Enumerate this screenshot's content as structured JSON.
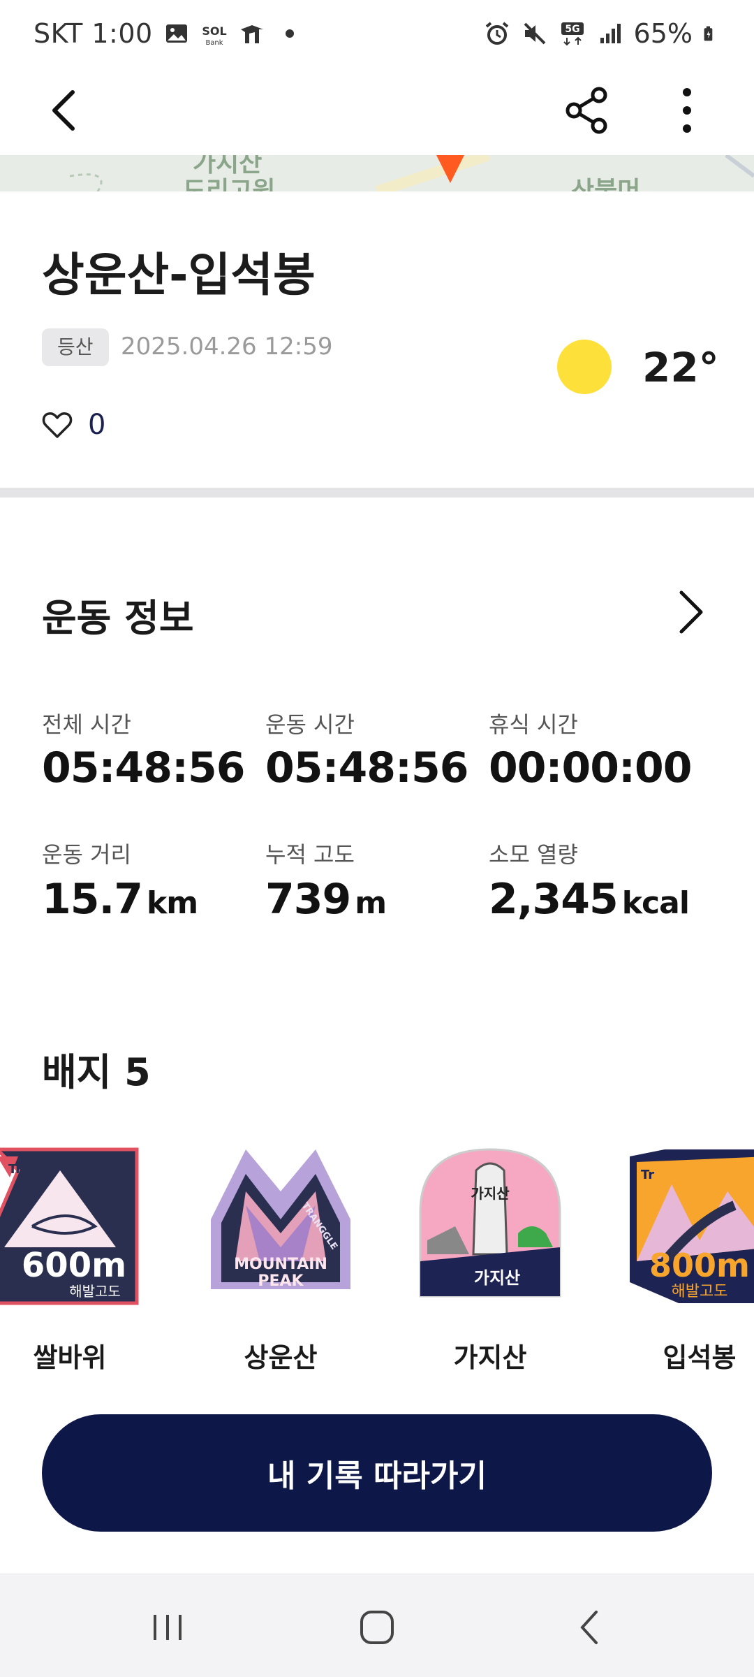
{
  "status_bar": {
    "carrier_time": "SKT 1:00",
    "battery": "65%",
    "notification_icons": [
      "gallery-icon",
      "shinhan-sol-bank-icon",
      "trangle-app-icon",
      "dot-icon"
    ],
    "system_icons": [
      "alarm-icon",
      "mute-icon",
      "5g-icon",
      "signal-icon",
      "battery-icon"
    ],
    "sol_bank_text": "Bank"
  },
  "app_bar": {
    "back_icon": "back-arrow-icon",
    "share_icon": "share-icon",
    "more_icon": "more-vertical-icon"
  },
  "map": {
    "labels": [
      "가지산",
      "도리고원",
      "산불머"
    ]
  },
  "record": {
    "title": "상운산-입석봉",
    "category": "등산",
    "datetime": "2025.04.26 12:59",
    "temperature": "22°",
    "weather_icon": "sun-icon",
    "likes": "0"
  },
  "exercise": {
    "section_title": "운동 정보",
    "stats": [
      {
        "label": "전체 시간",
        "value": "05:48:56",
        "unit": ""
      },
      {
        "label": "운동 시간",
        "value": "05:48:56",
        "unit": ""
      },
      {
        "label": "휴식 시간",
        "value": "00:00:00",
        "unit": ""
      },
      {
        "label": "운동 거리",
        "value": "15.7",
        "unit": "km"
      },
      {
        "label": "누적 고도",
        "value": "739",
        "unit": "m"
      },
      {
        "label": "소모 열량",
        "value": "2,345",
        "unit": "kcal"
      }
    ]
  },
  "badges": {
    "title": "배지 5",
    "items": [
      {
        "name": "쌀바위",
        "art_text": "600m",
        "art_sub": "해발고도",
        "brand": "Tr"
      },
      {
        "name": "상운산",
        "art_text": "MOUNTAIN",
        "art_sub": "PEAK",
        "brand": "TRANGGLE"
      },
      {
        "name": "가지산",
        "art_text": "가지산",
        "art_sub": "가지산"
      },
      {
        "name": "입석봉",
        "art_text": "800m",
        "art_sub": "해발고도",
        "brand": "Tr"
      }
    ]
  },
  "cta": {
    "label": "내 기록 따라가기"
  },
  "nav_bar": {
    "icons": [
      "recent-apps-icon",
      "home-icon",
      "nav-back-icon"
    ]
  },
  "colors": {
    "primary_dark_navy": "#0e1848",
    "sun_yellow": "#fde03a",
    "chip_bg": "#e8e8ea"
  }
}
